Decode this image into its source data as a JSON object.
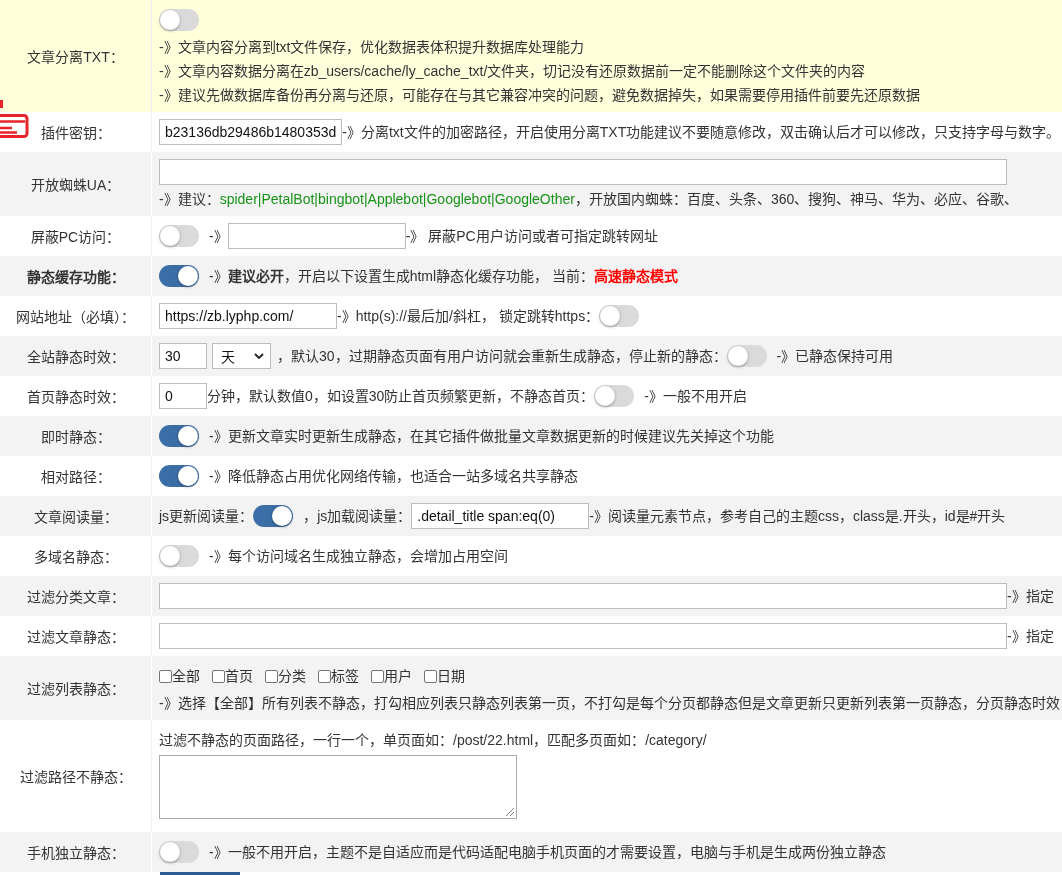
{
  "settings": [
    {
      "label": "文章分离TXT：",
      "highlighted": true,
      "emphasized": false,
      "lines": [
        [
          {
            "kind": "toggle",
            "on": false
          }
        ],
        [
          {
            "kind": "text",
            "text": "-》文章内容分离到txt文件保存，优化数据表体积提升数据库处理能力"
          }
        ],
        [
          {
            "kind": "text",
            "text": "-》文章内容数据分离在zb_users/cache/ly_cache_txt/文件夹，切记没有还原数据前一定不能删除这个文件夹的内容"
          }
        ],
        [
          {
            "kind": "text",
            "text": "-》建议先做数据库备份再分离与还原，可能存在与其它兼容冲突的问题，避免数据掉失，如果需要停用插件前要先还原数据"
          }
        ]
      ]
    },
    {
      "label": "插件密钥：",
      "highlighted": false,
      "emphasized": false,
      "lines": [
        [
          {
            "kind": "input",
            "value": "b23136db29486b1480353d"
          },
          {
            "kind": "text",
            "text": "-》分离txt文件的加密路径，开启使用分离TXT功能建议不要随意修改，双击确认后才可以修改，只支持字母与数字。"
          }
        ]
      ]
    },
    {
      "label": "开放蜘蛛UA：",
      "highlighted": false,
      "emphasized": false,
      "lines": [
        [
          {
            "kind": "wideinput"
          }
        ],
        [
          {
            "kind": "text",
            "text": "-》建议："
          },
          {
            "kind": "accent",
            "text": "spider|PetalBot|bingbot|Applebot|Googlebot|GoogleOther"
          },
          {
            "kind": "text",
            "text": "，开放国内蜘蛛：百度、头条、360、搜狗、神马、华为、必应、谷歌、"
          }
        ]
      ]
    },
    {
      "label": "屏蔽PC访问：",
      "highlighted": false,
      "emphasized": false,
      "lines": [
        [
          {
            "kind": "toggle",
            "on": false
          },
          {
            "kind": "text",
            "text": "-》"
          },
          {
            "kind": "input"
          },
          {
            "kind": "text",
            "text": "-》 屏蔽PC用户访问或者可指定跳转网址"
          }
        ]
      ]
    },
    {
      "label": "静态缓存功能：",
      "highlighted": false,
      "emphasized": true,
      "lines": [
        [
          {
            "kind": "toggle",
            "on": true
          },
          {
            "kind": "text",
            "text": "-》**建议必开**，开启以下设置生成html静态化缓存功能， 当前："
          },
          {
            "kind": "status",
            "text": "高速静态模式"
          }
        ]
      ]
    },
    {
      "label": "网站地址（必填）：",
      "highlighted": false,
      "emphasized": false,
      "lines": [
        [
          {
            "kind": "input",
            "value": "https://zb.lyphp.com/"
          },
          {
            "kind": "text",
            "text": "-》http(s)://最后加/斜杠， 锁定跳转https："
          },
          {
            "kind": "toggle",
            "on": false
          }
        ]
      ]
    },
    {
      "label": "全站静态时效：",
      "highlighted": false,
      "emphasized": false,
      "lines": [
        [
          {
            "kind": "number",
            "value": "30"
          },
          {
            "kind": "select",
            "value": "天"
          },
          {
            "kind": "text",
            "text": "，默认30，过期静态页面有用户访问就会重新生成静态，停止新的静态："
          },
          {
            "kind": "toggle",
            "on": false
          },
          {
            "kind": "text",
            "text": "-》已静态保持可用"
          }
        ]
      ]
    },
    {
      "label": "首页静态时效：",
      "highlighted": false,
      "emphasized": false,
      "lines": [
        [
          {
            "kind": "number",
            "value": "0"
          },
          {
            "kind": "text",
            "text": "分钟，默认数值0，如设置30防止首页频繁更新，不静态首页："
          },
          {
            "kind": "toggle",
            "on": false
          },
          {
            "kind": "text",
            "text": "-》一般不用开启"
          }
        ]
      ]
    },
    {
      "label": "即时静态：",
      "highlighted": false,
      "emphasized": false,
      "lines": [
        [
          {
            "kind": "toggle",
            "on": true
          },
          {
            "kind": "text",
            "text": "-》更新文章实时更新生成静态，在其它插件做批量文章数据更新的时候建议先关掉这个功能"
          }
        ]
      ]
    },
    {
      "label": "相对路径：",
      "highlighted": false,
      "emphasized": false,
      "lines": [
        [
          {
            "kind": "toggle",
            "on": true
          },
          {
            "kind": "text",
            "text": "-》降低静态占用优化网络传输，也适合一站多域名共享静态"
          }
        ]
      ]
    },
    {
      "label": "文章阅读量：",
      "highlighted": false,
      "emphasized": false,
      "lines": [
        [
          {
            "kind": "text",
            "text": "js更新阅读量："
          },
          {
            "kind": "toggle",
            "on": true
          },
          {
            "kind": "text",
            "text": "，js加载阅读量："
          },
          {
            "kind": "input",
            "value": ".detail_title span:eq(0)"
          },
          {
            "kind": "text",
            "text": "-》阅读量元素节点，参考自己的主题css，class是.开头，id是#开头"
          }
        ]
      ]
    },
    {
      "label": "多域名静态：",
      "highlighted": false,
      "emphasized": false,
      "lines": [
        [
          {
            "kind": "toggle",
            "on": false
          },
          {
            "kind": "text",
            "text": "-》每个访问域名生成独立静态，会增加占用空间"
          }
        ]
      ]
    },
    {
      "label": "过滤分类文章：",
      "highlighted": false,
      "emphasized": false,
      "lines": [
        [
          {
            "kind": "wideinput"
          },
          {
            "kind": "text",
            "text": "-》指定"
          }
        ]
      ]
    },
    {
      "label": "过滤文章静态：",
      "highlighted": false,
      "emphasized": false,
      "lines": [
        [
          {
            "kind": "wideinput"
          },
          {
            "kind": "text",
            "text": "-》指定"
          }
        ]
      ]
    },
    {
      "label": "过滤列表静态：",
      "highlighted": false,
      "emphasized": false,
      "lines": [
        [
          {
            "kind": "checkbox",
            "label": "全部",
            "checked": false
          },
          {
            "kind": "checkbox",
            "label": "首页",
            "checked": false
          },
          {
            "kind": "checkbox",
            "label": "分类",
            "checked": false
          },
          {
            "kind": "checkbox",
            "label": "标签",
            "checked": false
          },
          {
            "kind": "checkbox",
            "label": "用户",
            "checked": false
          },
          {
            "kind": "checkbox",
            "label": "日期",
            "checked": false
          }
        ],
        [
          {
            "kind": "text",
            "text": "-》选择【全部】所有列表不静态，打勾相应列表只静态列表第一页，不打勾是每个分页都静态但是文章更新只更新列表第一页静态，分页静态时效"
          }
        ]
      ]
    },
    {
      "label": "过滤路径不静态：",
      "highlighted": false,
      "emphasized": false,
      "lines": [
        [
          {
            "kind": "text",
            "text": "过滤不静态的页面路径，一行一个，单页面如：/post/22.html，匹配多页面如：/category/"
          }
        ],
        [
          {
            "kind": "textarea"
          }
        ]
      ]
    },
    {
      "label": "手机独立静态：",
      "highlighted": false,
      "emphasized": false,
      "lines": [
        [
          {
            "kind": "toggle",
            "on": false
          },
          {
            "kind": "text",
            "text": "-》一般不用开启，主题不是自适应而是代码适配电脑手机页面的才需要设置，电脑与手机是生成两份独立静态"
          }
        ]
      ]
    }
  ]
}
